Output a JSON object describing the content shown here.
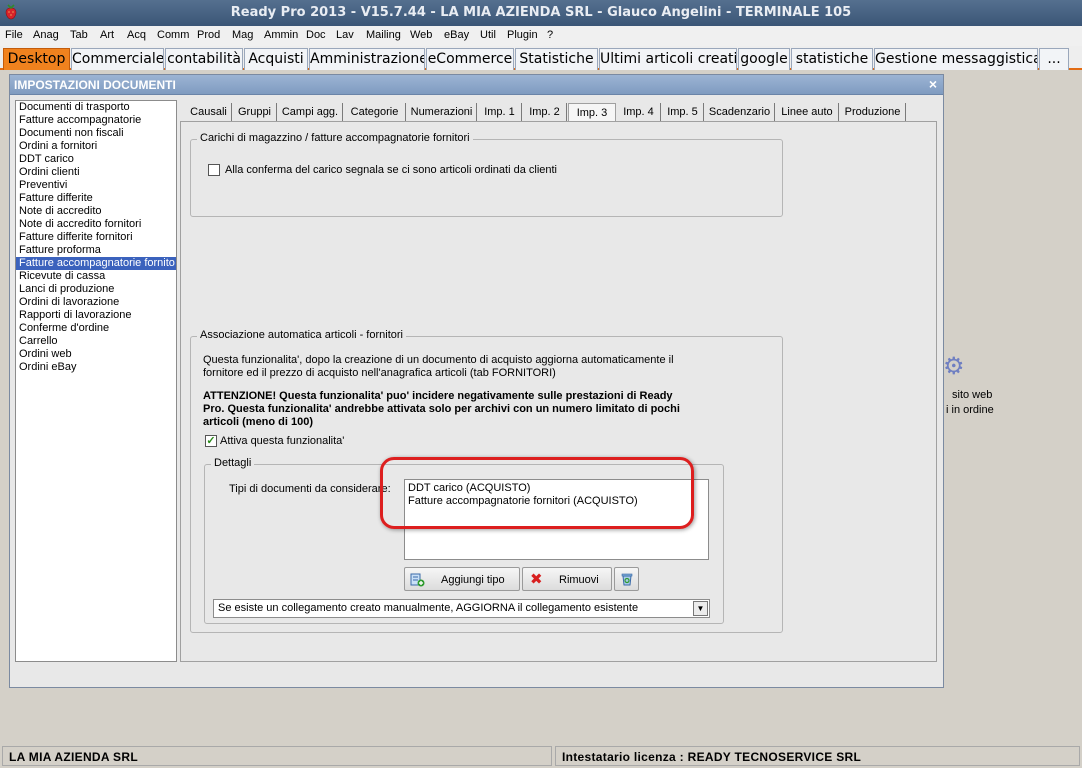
{
  "app": {
    "title": "Ready Pro 2013 - V15.7.44 - LA MIA AZIENDA SRL - Glauco Angelini - TERMINALE 105"
  },
  "menu": [
    "File",
    "Anag",
    "Tab",
    "Art",
    "Acq",
    "Comm",
    "Prod",
    "Mag",
    "Ammin",
    "Doc",
    "Lav",
    "Mailing",
    "Web",
    "eBay",
    "Util",
    "Plugin",
    "?"
  ],
  "top_tabs": [
    "Desktop",
    "Commerciale",
    "contabilità",
    "Acquisti",
    "Amministrazione",
    "eCommerce",
    "Statistiche",
    "Ultimi articoli creati",
    "google",
    "statistiche",
    "Gestione messaggistica",
    "..."
  ],
  "dialog": {
    "title": "IMPOSTAZIONI DOCUMENTI",
    "close": "×",
    "documents": [
      "Documenti di trasporto",
      "Fatture accompagnatorie",
      "Documenti non fiscali",
      "Ordini a fornitori",
      "DDT carico",
      "Ordini clienti",
      "Preventivi",
      "Fatture differite",
      "Note di accredito",
      "Note di accredito fornitori",
      "Fatture differite fornitori",
      "Fatture proforma",
      "Fatture accompagnatorie fornito",
      "Ricevute di cassa",
      "Lanci di produzione",
      "Ordini di lavorazione",
      "Rapporti di lavorazione",
      "Conferme d'ordine",
      "Carrello",
      "Ordini web",
      "Ordini eBay"
    ],
    "selected_document": "Fatture accompagnatorie fornito",
    "tabs": [
      "Causali",
      "Gruppi",
      "Campi agg.",
      "Categorie",
      "Numerazioni",
      "Imp. 1",
      "Imp. 2",
      "Imp. 3",
      "Imp. 4",
      "Imp. 5",
      "Scadenzario",
      "Linee auto",
      "Produzione"
    ],
    "active_tab": "Imp. 3",
    "group1": {
      "legend": "Carichi di magazzino / fatture accompagnatorie fornitori",
      "checkbox_label": "Alla conferma del carico segnala se ci sono articoli ordinati da clienti",
      "checked": false
    },
    "group2": {
      "legend": "Associazione automatica articoli - fornitori",
      "description": "Questa funzionalita', dopo la creazione di un documento di acquisto aggiorna automaticamente il fornitore ed il prezzo di acquisto nell'anagrafica articoli (tab FORNITORI)",
      "warning": "ATTENZIONE! Questa funzionalita' puo' incidere negativamente sulle prestazioni di Ready Pro. Questa funzionalita' andrebbe attivata solo per archivi con un numero limitato di pochi articoli (meno di 100)",
      "checkbox_label": "Attiva questa funzionalita'",
      "checked": true,
      "checkmark": "✓",
      "details": {
        "legend": "Dettagli",
        "types_label": "Tipi di documenti da considerare:",
        "types": [
          "DDT carico (ACQUISTO)",
          "Fatture accompagnatorie fornitori (ACQUISTO)"
        ],
        "add_button": "Aggiungi tipo",
        "remove_button": "Rimuovi",
        "remove_glyph": "✖",
        "link_select": "Se esiste un collegamento creato manualmente, AGGIORNA il collegamento esistente",
        "select_arrow": "▼"
      }
    }
  },
  "desktop": {
    "gear_glyph": "⚙",
    "text1": "sito web",
    "text2": "i in ordine"
  },
  "status": {
    "company": "LA MIA AZIENDA SRL",
    "license": "Intestatario licenza : READY TECNOSERVICE SRL"
  },
  "colors": {
    "active_tab": "#f0821e",
    "selection": "#3b62bd",
    "highlight_ring": "#dd1f1f"
  }
}
